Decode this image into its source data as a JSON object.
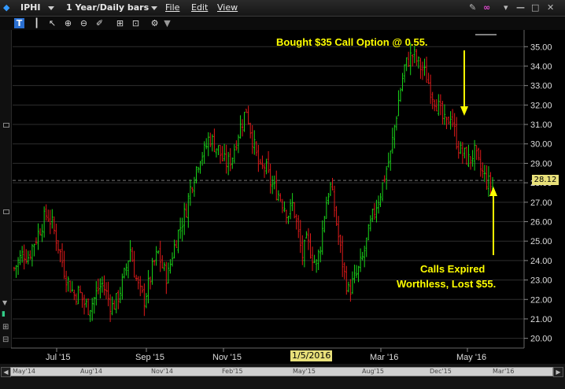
{
  "titlebar": {
    "symbol": "IPHI",
    "timeframe": "1 Year/Daily bars",
    "menu": [
      "File",
      "Edit",
      "View"
    ]
  },
  "annotations": {
    "bought": "Bought $35 Call Option @ 0.55.",
    "expired_line1": "Calls Expired",
    "expired_line2": "Worthless, Lost $55."
  },
  "current_price_label": "28.12",
  "crosshair_date_label": "1/5/2016",
  "scrollbar_labels": [
    "May'14",
    "Aug'14",
    "Nov'14",
    "Feb'15",
    "May'15",
    "Aug'15",
    "Dec'15",
    "Mar'16"
  ],
  "colors": {
    "up": "#19d419",
    "down": "#e01a1a",
    "annotation": "#ffff00",
    "grid": "#2e2e2e",
    "highlight": "#e8e07a"
  },
  "chart_data": {
    "type": "candlestick",
    "x_tick_labels": [
      "Jul '15",
      "Sep '15",
      "Nov '15",
      "Mar '16",
      "May '16"
    ],
    "y_ticks": [
      20.0,
      21.0,
      22.0,
      23.0,
      24.0,
      25.0,
      26.0,
      27.0,
      28.0,
      29.0,
      30.0,
      31.0,
      32.0,
      33.0,
      34.0,
      35.0
    ],
    "ylim": [
      19.5,
      35.7
    ],
    "current_price": 28.12,
    "close_series": [
      23.6,
      24.0,
      24.4,
      24.2,
      24.8,
      25.3,
      25.9,
      26.4,
      26.0,
      25.2,
      24.3,
      23.3,
      22.7,
      22.2,
      22.4,
      21.8,
      21.6,
      21.9,
      22.5,
      22.8,
      22.2,
      21.6,
      21.9,
      22.6,
      23.5,
      24.6,
      23.3,
      22.4,
      22.0,
      22.8,
      23.8,
      24.4,
      23.6,
      23.1,
      24.3,
      25.2,
      25.9,
      26.6,
      27.8,
      28.6,
      29.4,
      29.6,
      30.4,
      30.0,
      29.7,
      29.1,
      29.0,
      29.4,
      30.4,
      31.1,
      31.8,
      30.6,
      29.5,
      28.6,
      28.9,
      28.1,
      27.7,
      27.4,
      26.9,
      26.4,
      26.9,
      25.6,
      24.2,
      25.0,
      24.4,
      23.7,
      24.9,
      26.8,
      27.9,
      26.6,
      24.9,
      23.4,
      22.4,
      22.9,
      23.4,
      24.1,
      25.1,
      26.1,
      26.9,
      27.6,
      28.6,
      29.4,
      31.1,
      32.6,
      33.9,
      34.4,
      34.6,
      34.1,
      33.8,
      33.3,
      32.6,
      32.1,
      31.4,
      30.9,
      31.6,
      30.4,
      29.6,
      29.4,
      29.1,
      29.6,
      28.9,
      28.4,
      28.0,
      27.8
    ],
    "close_series_note_x": [
      "Jun '15",
      "Jul '15",
      "Sep '15",
      "Nov '15",
      "Jan '16",
      "Mar '16",
      "May '16"
    ]
  }
}
